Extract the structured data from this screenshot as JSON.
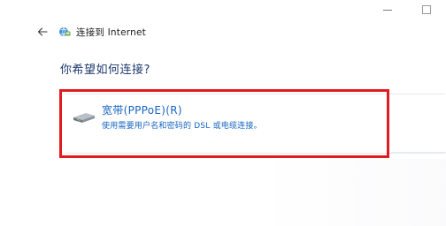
{
  "window": {
    "controls": {
      "minimize_icon": "minimize-icon",
      "maximize_icon": "maximize-icon"
    }
  },
  "header": {
    "back_icon": "arrow-left-icon",
    "network_icon": "network-globe-icon",
    "title": "连接到 Internet"
  },
  "main": {
    "question": "你希望如何连接?",
    "options": [
      {
        "title": "宽带(PPPoE)(R)",
        "description": "使用需要用户名和密码的 DSL 或电缆连接。",
        "icon": "broadband-modem-icon",
        "highlighted": true
      }
    ]
  },
  "colors": {
    "title_text": "#1e3a6e",
    "link_blue": "#1665c0",
    "highlight_red": "#e11b22"
  }
}
